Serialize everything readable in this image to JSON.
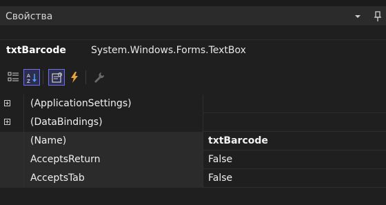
{
  "panel": {
    "title": "Свойства",
    "object_name": "txtBarcode",
    "object_type": "System.Windows.Forms.TextBox"
  },
  "toolbar": {
    "buttons": [
      {
        "icon": "categorized-icon",
        "active": false
      },
      {
        "icon": "alphabetical-icon",
        "active": true
      },
      {
        "icon": "properties-icon",
        "active": true
      },
      {
        "icon": "events-icon",
        "active": false
      },
      {
        "icon": "property-pages-icon",
        "active": false
      }
    ]
  },
  "grid": {
    "rows": [
      {
        "name": "(ApplicationSettings)",
        "value": "",
        "expandable": true
      },
      {
        "name": "(DataBindings)",
        "value": "",
        "expandable": true
      },
      {
        "name": "(Name)",
        "value": "txtBarcode",
        "expandable": false,
        "value_bold": true
      },
      {
        "name": "AcceptsReturn",
        "value": "False",
        "expandable": false
      },
      {
        "name": "AcceptsTab",
        "value": "False",
        "expandable": false
      }
    ]
  },
  "colors": {
    "accent": "#6f6ff0",
    "background": "#1f1f1f",
    "titlebar": "#2b2b2b",
    "events_icon": "#e8a33d"
  }
}
